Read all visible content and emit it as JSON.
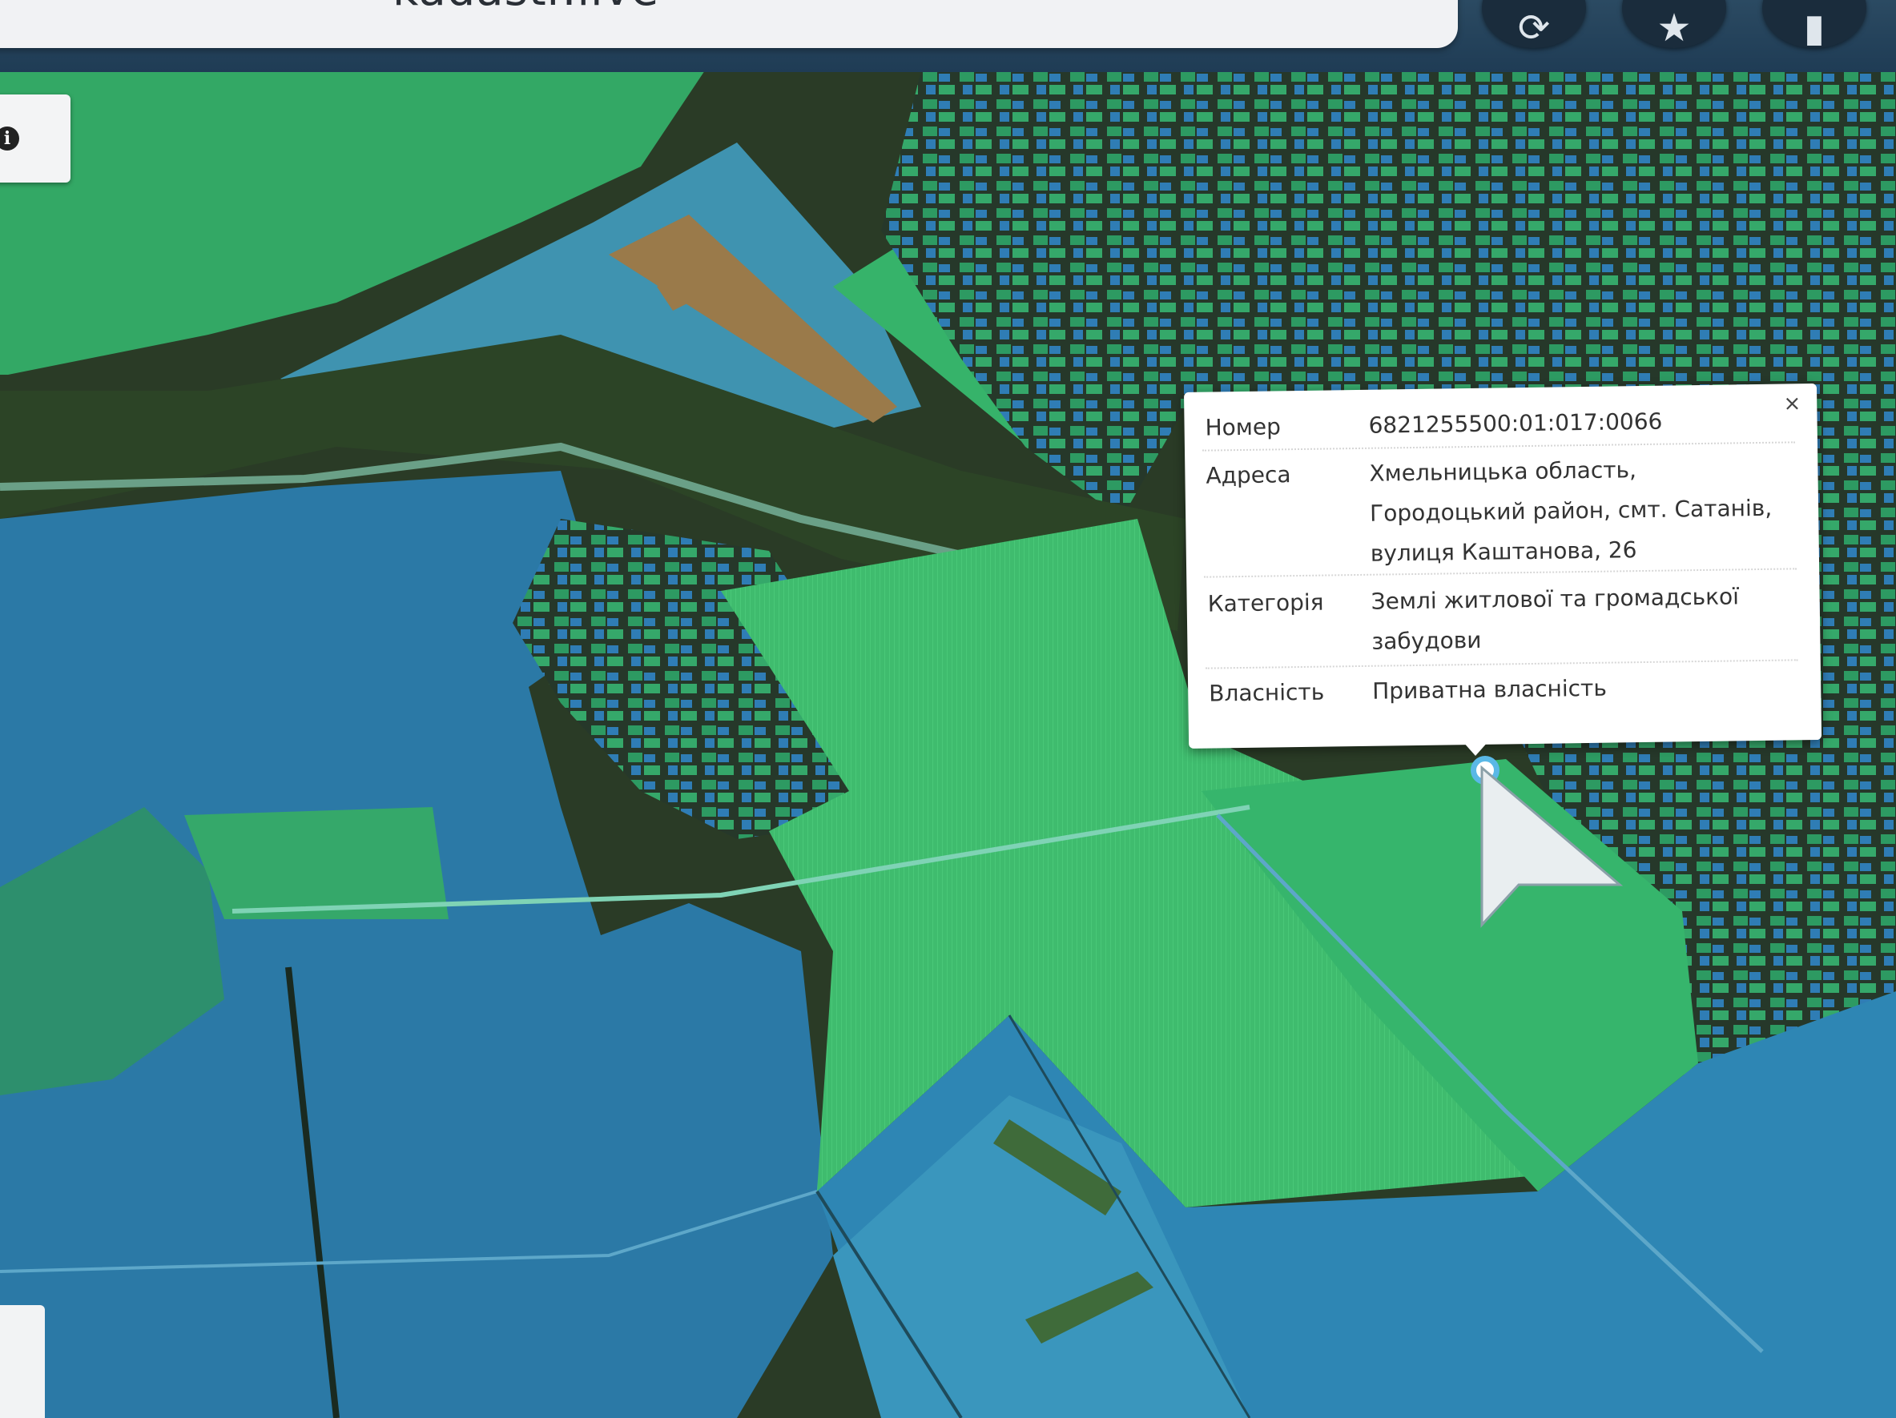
{
  "browser": {
    "url": "kadastr.live"
  },
  "map": {
    "info_button": "i"
  },
  "popup": {
    "close_label": "×",
    "rows": [
      {
        "key": "Номер",
        "value": "6821255500:01:017:0066"
      },
      {
        "key": "Адреса",
        "value": "Хмельницька область, Городоцький район, смт. Сатанів, вулиця Каштанова, 26"
      },
      {
        "key": "Категорія",
        "value": "Землі житлової та громадської забудови"
      },
      {
        "key": "Власність",
        "value": "Приватна власність"
      }
    ]
  },
  "colors": {
    "parcel_green": "#34b46a",
    "parcel_blue": "#2a86b8",
    "parcel_dark_blue": "#1d5d8a",
    "popup_bg": "#ffffff",
    "marker": "#5ab8e6"
  },
  "icons": {
    "toolbar": [
      "refresh-icon",
      "star-icon",
      "download-icon"
    ]
  }
}
